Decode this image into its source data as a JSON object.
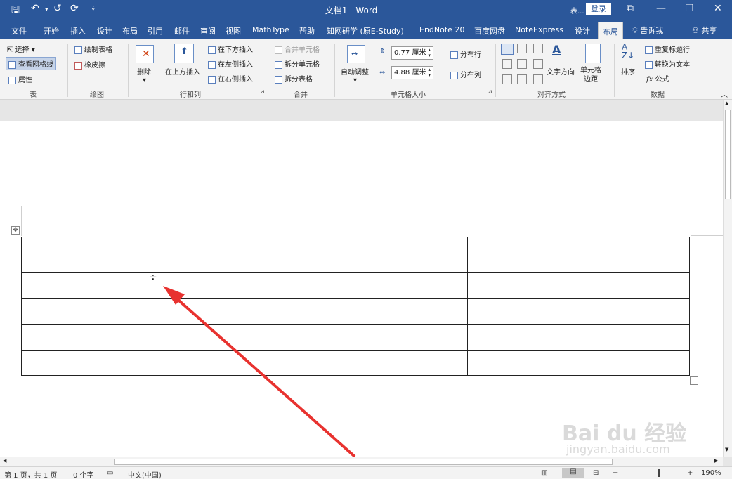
{
  "window": {
    "doc_title": "文档1 - Word",
    "account_short": "表...",
    "login_button": "登录",
    "restore_icon": "ribbon-display-icon",
    "minimize_icon": "minimize-icon",
    "maximize_icon": "maximize-icon",
    "close_icon": "close-icon"
  },
  "quick_access": {
    "save_icon": "save-icon",
    "undo_icon": "undo-icon",
    "redo_icon": "redo-icon",
    "refresh_icon": "refresh-icon",
    "customize_icon": "customize-icon"
  },
  "tabs": [
    "文件",
    "开始",
    "插入",
    "设计",
    "布局",
    "引用",
    "邮件",
    "审阅",
    "视图",
    "MathType",
    "帮助",
    "知网研学 (原E-Study)",
    "EndNote 20",
    "百度网盘",
    "NoteExpress",
    "设计",
    "布局"
  ],
  "active_tab_index": 16,
  "tell_me": "告诉我",
  "share": "共享",
  "ribbon": {
    "table_group": {
      "select": "选择",
      "view_gridlines": "查看网格线",
      "properties": "属性",
      "label": "表"
    },
    "draw_group": {
      "draw_table": "绘制表格",
      "eraser": "橡皮擦",
      "label": "绘图"
    },
    "rows_cols_group": {
      "delete": "删除",
      "insert_above": "在上方插入",
      "insert_below": "在下方插入",
      "insert_left": "在左侧插入",
      "insert_right": "在右侧插入",
      "label": "行和列"
    },
    "merge_group": {
      "merge_cells": "合并单元格",
      "split_cells": "拆分单元格",
      "split_table": "拆分表格",
      "label": "合并"
    },
    "cell_size_group": {
      "autofit": "自动调整",
      "height_value": "0.77 厘米",
      "width_value": "4.88 厘米",
      "distribute_rows": "分布行",
      "distribute_cols": "分布列",
      "label": "单元格大小"
    },
    "align_group": {
      "text_direction": "文字方向",
      "cell_margins_1": "单元格",
      "cell_margins_2": "边距",
      "label": "对齐方式"
    },
    "data_group": {
      "sort": "排序",
      "repeat_header": "重复标题行",
      "convert_to_text": "转换为文本",
      "formula": "公式",
      "label": "数据"
    }
  },
  "table": {
    "rows": 5,
    "cols": 3,
    "cursor_glyph": "÷"
  },
  "status": {
    "page": "第 1 页，共 1 页",
    "words": "0 个字",
    "language": "中文(中国)",
    "zoom": "190%",
    "zoom_minus": "−",
    "zoom_plus": "+"
  },
  "watermark": {
    "brand": "Bai du 经验",
    "url": "jingyan.baidu.com"
  },
  "colors": {
    "accent": "#2b579a",
    "annotation_arrow": "#e8322f"
  }
}
